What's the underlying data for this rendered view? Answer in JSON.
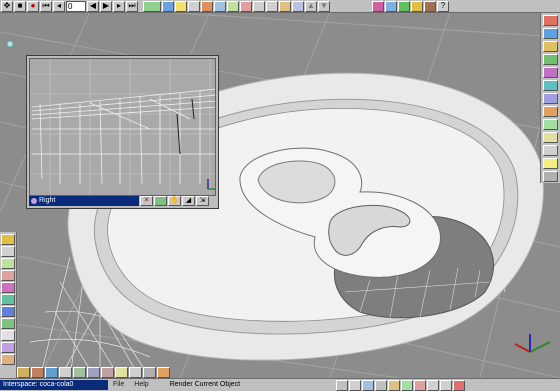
{
  "top_toolbar": {
    "frame_value": "0",
    "buttons": [
      "move-icon",
      "stop-icon",
      "record-icon",
      "rewind-start-icon",
      "step-back-icon",
      "frame-field",
      "play-backward-icon",
      "play-icon",
      "step-forward-icon",
      "forward-end-icon",
      "render-icon",
      "material-icon",
      "light-icon",
      "camera-icon",
      "object-icon",
      "spline-icon",
      "deform-icon",
      "animate-icon",
      "link-icon",
      "unlink-icon",
      "bone-icon",
      "morph-icon",
      "up-icon",
      "down-icon",
      "palette-icon",
      "sphere-icon",
      "globe-icon",
      "rainbow-icon",
      "cube-icon",
      "help-icon"
    ]
  },
  "subview": {
    "title": "Right"
  },
  "status_bar": {
    "interspace_label": "Interspace: coca-cola0",
    "file_menu": "File",
    "help_menu": "Help",
    "status_text": "Render Current Object"
  },
  "colors": {
    "background": "#8c8c8c",
    "grid": "#a6a6a6",
    "lid_fill": "#f2f2f2",
    "titlebar": "#0a2a7a"
  }
}
